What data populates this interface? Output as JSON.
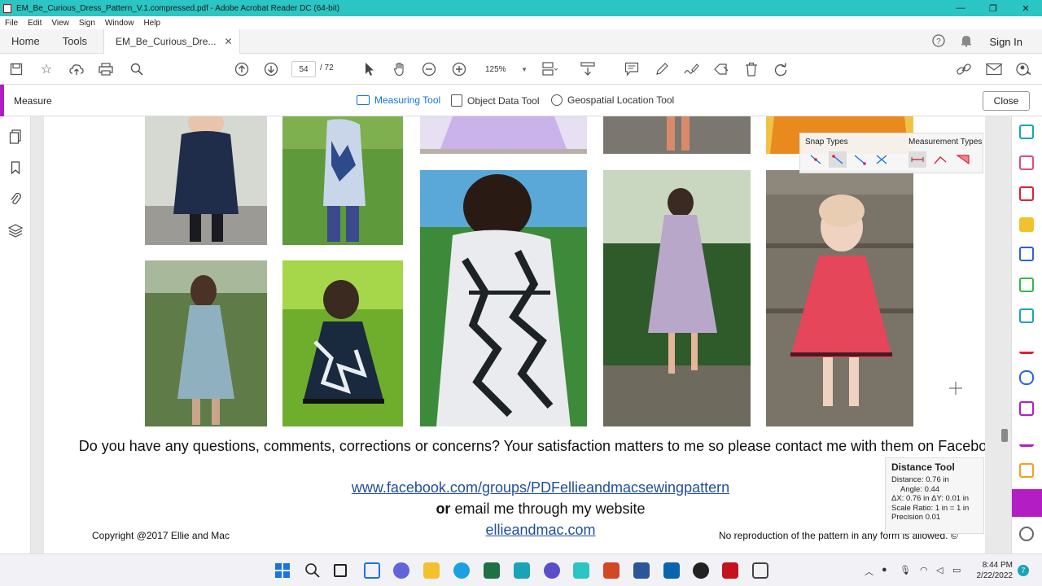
{
  "window": {
    "title": "EM_Be_Curious_Dress_Pattern_V.1.compressed.pdf - Adobe Acrobat Reader DC (64-bit)"
  },
  "menu": [
    "File",
    "Edit",
    "View",
    "Sign",
    "Window",
    "Help"
  ],
  "tabs": {
    "home": "Home",
    "tools": "Tools",
    "document": "EM_Be_Curious_Dre...",
    "sign_in": "Sign In"
  },
  "toolbar": {
    "current_page": "54",
    "total_pages": "/ 72",
    "zoom": "125%"
  },
  "measure_bar": {
    "title": "Measure",
    "tools": [
      "Measuring Tool",
      "Object Data Tool",
      "Geospatial Location Tool"
    ],
    "active_tool": "Measuring Tool",
    "close_label": "Close"
  },
  "snap_panel": {
    "snap_types_label": "Snap Types",
    "measurement_types_label": "Measurement Types"
  },
  "distance_tool": {
    "title": "Distance Tool",
    "distance": "Distance: 0.76 in",
    "angle": "Angle: 0.44",
    "delta": "ΔX: 0.76 in    ΔY: 0.01 in",
    "scale": "Scale Ratio:  1 in = 1 in",
    "precision": "Precision       0.01"
  },
  "page_content": {
    "question": "Do you have any questions, comments, corrections or concerns? Your satisfaction matters to me so please contact me with them on Facebook",
    "facebook_link": "www.facebook.com/groups/PDFellieandmacsewingpattern",
    "or_word": "or",
    "email_text": "email me through my website",
    "website_link": "ellieandmac.com",
    "copyright": "Copyright @2017 Ellie and Mac",
    "no_reproduction": "No reproduction of the pattern in any form is allowed. ©"
  },
  "taskbar": {
    "time": "8:44 PM",
    "date": "2/22/2022",
    "notifications": "7"
  },
  "colors": {
    "title_bar": "#2bc5c3",
    "measure_accent": "#b21ec4",
    "link": "#1f4e9c",
    "active_tool": "#1473e6"
  }
}
